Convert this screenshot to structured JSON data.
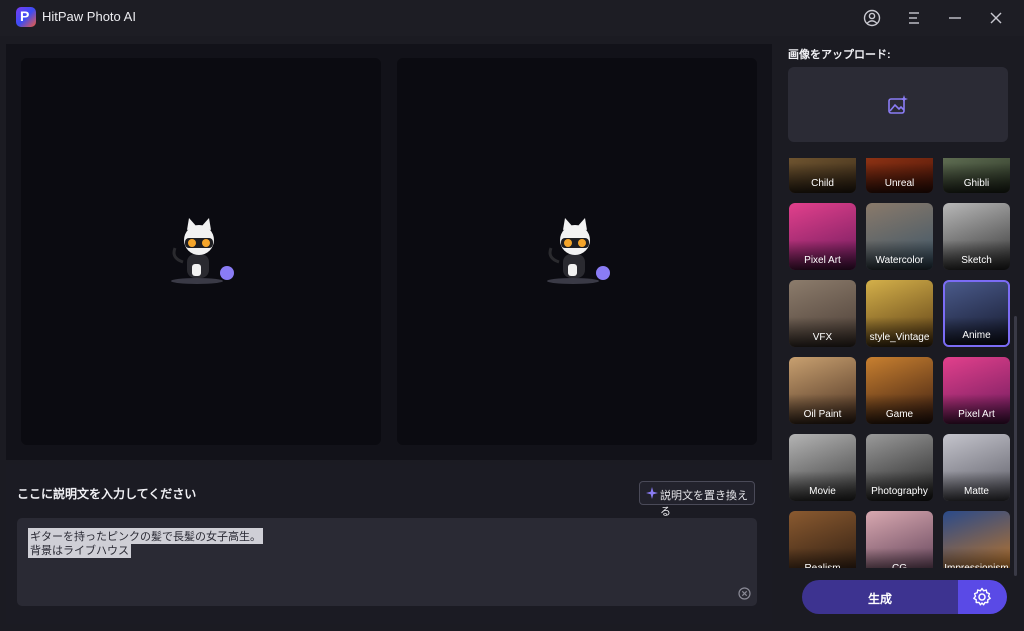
{
  "app": {
    "title": "HitPaw Photo AI",
    "logo_letter": "P"
  },
  "titlebar_icons": [
    "account-icon",
    "menu-icon",
    "minimize-icon",
    "close-icon"
  ],
  "prompt": {
    "title": "ここに説明文を入力してください",
    "replace_label": "説明文を置き換える",
    "lines": [
      "ギターを持ったピンクの髪で長髪の女子高生。",
      "背景はライブハウス"
    ]
  },
  "upload": {
    "label": "画像をアップロード:"
  },
  "styles": [
    {
      "label": "Child",
      "colors": [
        "#8a6a3c",
        "#3a2a18"
      ]
    },
    {
      "label": "Unreal",
      "colors": [
        "#b0421a",
        "#4a1408"
      ]
    },
    {
      "label": "Ghibli",
      "colors": [
        "#7a8a6a",
        "#2a3424"
      ]
    },
    {
      "label": "Pixel Art",
      "colors": [
        "#e2408c",
        "#6a1a5c"
      ]
    },
    {
      "label": "Watercolor",
      "colors": [
        "#8a7a6a",
        "#3a5468"
      ]
    },
    {
      "label": "Sketch",
      "colors": [
        "#b8b8b8",
        "#333333"
      ]
    },
    {
      "label": "VFX",
      "colors": [
        "#8c7c6c",
        "#4a3c34"
      ]
    },
    {
      "label": "style_Vintage",
      "colors": [
        "#d4b04a",
        "#5a3c14"
      ]
    },
    {
      "label": "Anime",
      "colors": [
        "#4a5a8a",
        "#14182c"
      ]
    },
    {
      "label": "Oil Paint",
      "colors": [
        "#c8a070",
        "#4a3020"
      ]
    },
    {
      "label": "Game",
      "colors": [
        "#c88030",
        "#3a1c10"
      ]
    },
    {
      "label": "Pixel Art",
      "colors": [
        "#e2408c",
        "#6a1a5c"
      ]
    },
    {
      "label": "Movie",
      "colors": [
        "#b4b4b4",
        "#3a3a3a"
      ]
    },
    {
      "label": "Photography",
      "colors": [
        "#9a9a9a",
        "#222222"
      ]
    },
    {
      "label": "Matte",
      "colors": [
        "#c4c4cc",
        "#5a5a64"
      ]
    },
    {
      "label": "Realism",
      "colors": [
        "#8a5a30",
        "#2a1a10"
      ]
    },
    {
      "label": "CG",
      "colors": [
        "#d8a8b0",
        "#5a3c54"
      ]
    },
    {
      "label": "Impressionism",
      "colors": [
        "#2a4a8a",
        "#c87820"
      ]
    }
  ],
  "selected_style": "Anime",
  "generate": {
    "label": "生成"
  },
  "colors": {
    "accent": "#5a4ae6",
    "generate_bg": "#3d3390",
    "selected_border": "#7b6cf5"
  }
}
